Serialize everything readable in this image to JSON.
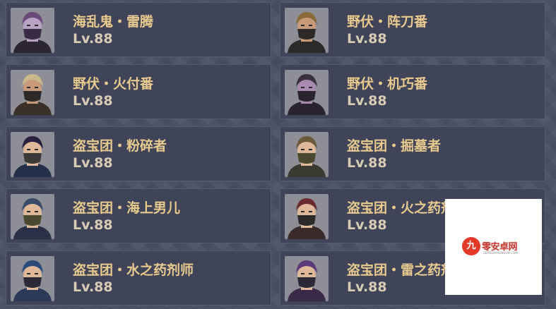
{
  "cards": [
    {
      "name": "海乱鬼・雷腾",
      "level": "Lv.88",
      "skin": "#b8a3c4",
      "cloth": "#2c2533",
      "hat": "#6a4a7a",
      "mask": "#3a2a45"
    },
    {
      "name": "野伏・阵刀番",
      "level": "Lv.88",
      "skin": "#c89a7a",
      "cloth": "#2c2a28",
      "hat": "#8b6a3a",
      "mask": "#2c2a28"
    },
    {
      "name": "野伏・火付番",
      "level": "Lv.88",
      "skin": "#c89a7a",
      "cloth": "#3a3028",
      "hat": "#c8b88a",
      "mask": "#2c2a28"
    },
    {
      "name": "野伏・机巧番",
      "level": "Lv.88",
      "skin": "#a88ab0",
      "cloth": "#2a2430",
      "hat": "#3a3040",
      "mask": "#2a2430"
    },
    {
      "name": "盗宝团・粉碎者",
      "level": "Lv.88",
      "skin": "#e0b89a",
      "cloth": "#24304a",
      "hat": "#2a2040",
      "mask": "#3a3a38"
    },
    {
      "name": "盗宝团・掘墓者",
      "level": "Lv.88",
      "skin": "#e0b89a",
      "cloth": "#3a3a30",
      "hat": "#6a5a3a",
      "mask": "#4a4a30"
    },
    {
      "name": "盗宝团・海上男儿",
      "level": "Lv.88",
      "skin": "#e0b89a",
      "cloth": "#2a3048",
      "hat": "#3a4a6a",
      "mask": "#4a4a30"
    },
    {
      "name": "盗宝团・火之药剂师",
      "level": "Lv.88",
      "skin": "#e0b89a",
      "cloth": "#3a2a2a",
      "hat": "#6a2a30",
      "mask": "#2a2a2a"
    },
    {
      "name": "盗宝团・水之药剂师",
      "level": "Lv.88",
      "skin": "#e0b89a",
      "cloth": "#2a3a58",
      "hat": "#2a4a7a",
      "mask": "#2a2a38"
    },
    {
      "name": "盗宝团・雷之药剂师",
      "level": "Lv.88",
      "skin": "#e0b89a",
      "cloth": "#3a2a48",
      "hat": "#5a3a7a",
      "mask": "#2a2a38"
    }
  ],
  "watermark": {
    "text": "零安卓网",
    "sub": "ZERODAYHONGOM.COM",
    "glyph": "九"
  }
}
